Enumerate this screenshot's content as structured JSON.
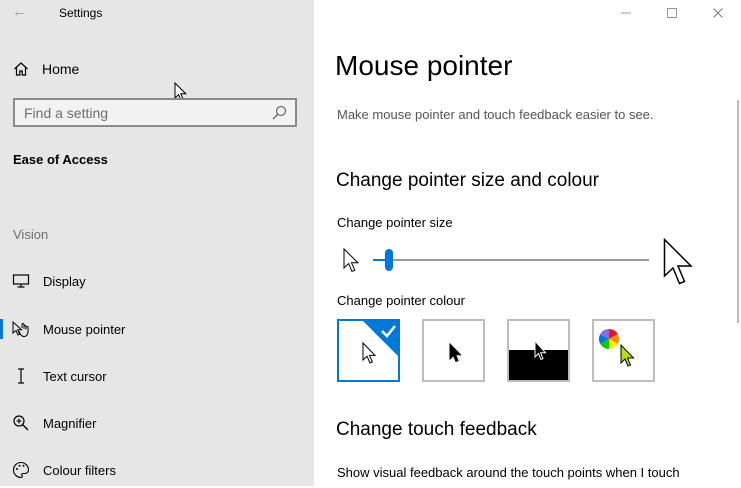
{
  "window": {
    "title": "Settings",
    "controls": {
      "minimize_icon": "minimize-icon",
      "maximize_icon": "maximize-icon",
      "close_icon": "close-icon"
    }
  },
  "sidebar": {
    "back_icon": "back-arrow-icon",
    "home_label": "Home",
    "search": {
      "placeholder": "Find a setting",
      "value": ""
    },
    "section_title": "Ease of Access",
    "group_label": "Vision",
    "items": [
      {
        "label": "Display",
        "icon": "display-icon"
      },
      {
        "label": "Mouse pointer",
        "icon": "mouse-pointer-icon",
        "selected": true
      },
      {
        "label": "Text cursor",
        "icon": "text-cursor-icon"
      },
      {
        "label": "Magnifier",
        "icon": "magnifier-icon"
      },
      {
        "label": "Colour filters",
        "icon": "colour-filters-icon"
      }
    ]
  },
  "main": {
    "page_title": "Mouse pointer",
    "description": "Make mouse pointer and touch feedback easier to see.",
    "size_colour_heading": "Change pointer size and colour",
    "size_label": "Change pointer size",
    "size_value": 0,
    "size_range": [
      1,
      15
    ],
    "colour_label": "Change pointer colour",
    "colour_options": [
      {
        "name": "white",
        "selected": true
      },
      {
        "name": "black",
        "selected": false
      },
      {
        "name": "inverted",
        "selected": false
      },
      {
        "name": "custom",
        "selected": false
      }
    ],
    "touch_heading": "Change touch feedback",
    "touch_desc": "Show visual feedback around the touch points when I touch"
  },
  "colors": {
    "accent": "#0078d7",
    "sidebar_bg": "#e6e6e6",
    "custom_pointer": "#b4e000"
  }
}
